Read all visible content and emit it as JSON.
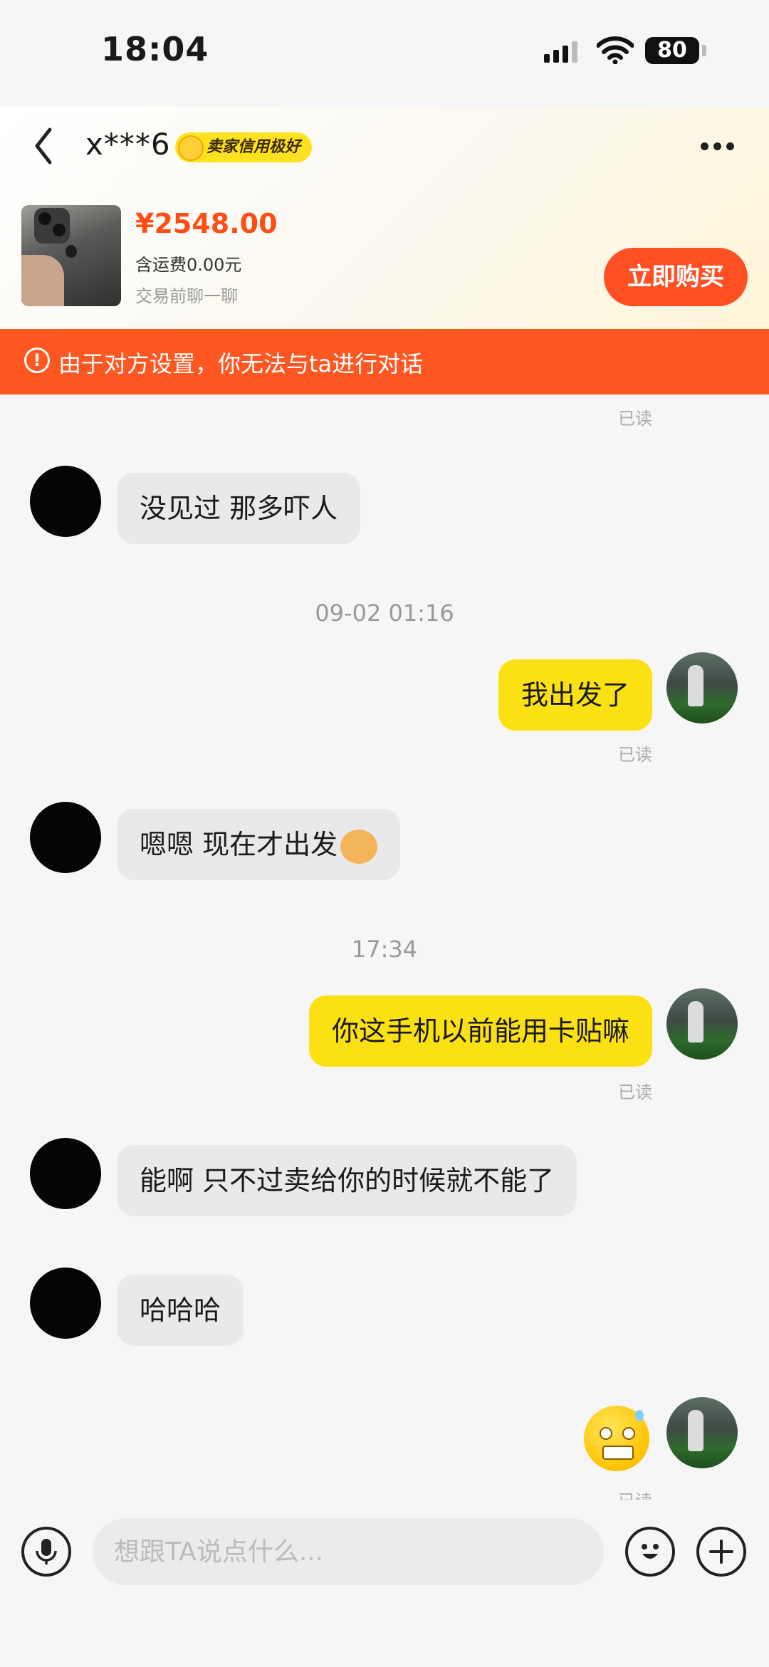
{
  "status_bar": {
    "time": "18:04",
    "battery": "80"
  },
  "header": {
    "seller_name": "x***6",
    "credit_badge": "卖家信用极好",
    "icons": {
      "back": "chevron-left-icon",
      "more": "ellipsis-icon"
    }
  },
  "product": {
    "price": "¥2548.00",
    "shipping": "含运费0.00元",
    "subtitle": "交易前聊一聊",
    "buy_label": "立即购买"
  },
  "warning": {
    "text": "由于对方设置，你无法与ta进行对话",
    "icon": "exclamation-circle-icon",
    "color": "#ff5722"
  },
  "messages": [
    {
      "type": "read",
      "text": "已读"
    },
    {
      "type": "incoming",
      "text": "没见过 那多吓人"
    },
    {
      "type": "timestamp",
      "text": "09-02 01:16"
    },
    {
      "type": "outgoing",
      "text": "我出发了"
    },
    {
      "type": "read",
      "text": "已读"
    },
    {
      "type": "incoming",
      "text": "嗯嗯 现在才出发",
      "emoji": "shiba-dog-emoji"
    },
    {
      "type": "timestamp",
      "text": "17:34"
    },
    {
      "type": "outgoing",
      "text": "你这手机以前能用卡贴嘛"
    },
    {
      "type": "read",
      "text": "已读"
    },
    {
      "type": "incoming",
      "text": "能啊 只不过卖给你的时候就不能了"
    },
    {
      "type": "incoming",
      "text": "哈哈哈"
    },
    {
      "type": "outgoing-sticker",
      "emoji": "nervous-sweat-face-emoji"
    },
    {
      "type": "read",
      "text": "已读"
    }
  ],
  "input": {
    "placeholder": "想跟TA说点什么..."
  },
  "colors": {
    "accent_yellow": "#fbe114",
    "accent_orange": "#ff5024"
  }
}
